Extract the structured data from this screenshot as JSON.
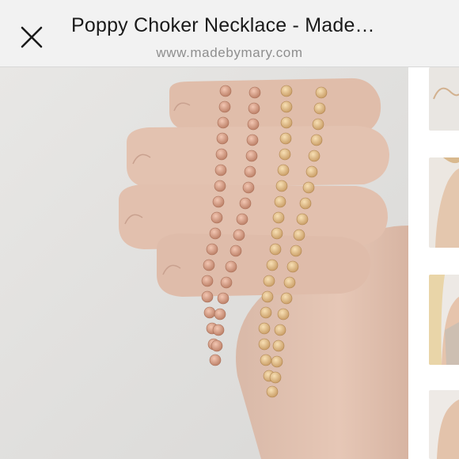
{
  "header": {
    "title": "Poppy Choker Necklace - Made…",
    "url": "www.madebymary.com",
    "close_icon": "close-icon"
  },
  "main_image": {
    "subject": "photo-hand-holding-necklaces"
  },
  "thumbnails": [
    {
      "icon": "thumbnail-image"
    },
    {
      "icon": "thumbnail-image"
    },
    {
      "icon": "thumbnail-image"
    },
    {
      "icon": "thumbnail-image"
    }
  ]
}
